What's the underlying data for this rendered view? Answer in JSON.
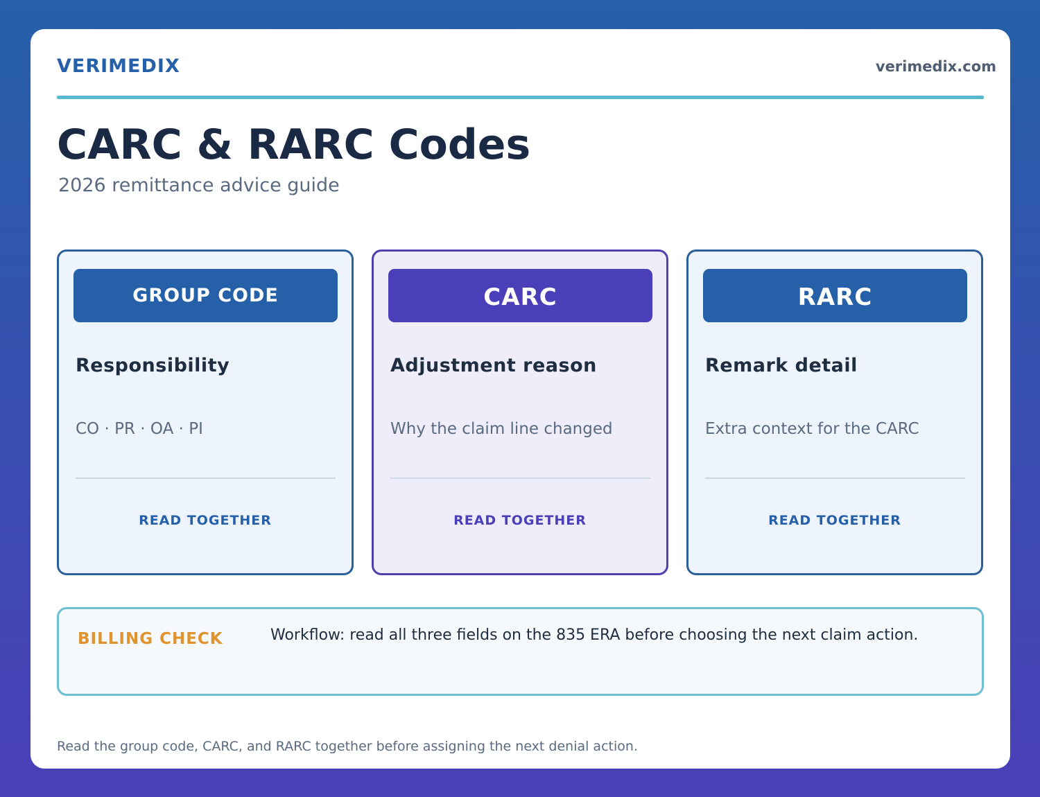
{
  "header": {
    "brand": "VERIMEDIX",
    "site": "verimedix.com"
  },
  "title": "CARC & RARC Codes",
  "subtitle": "2026 remittance advice guide",
  "panels": [
    {
      "head": "GROUP CODE",
      "title": "Responsibility",
      "description": "CO · PR · OA · PI",
      "footer": "READ TOGETHER",
      "accent": "#2560a8"
    },
    {
      "head": "CARC",
      "title": "Adjustment reason",
      "description": "Why the claim line changed",
      "footer": "READ TOGETHER",
      "accent": "#4a3fb8"
    },
    {
      "head": "RARC",
      "title": "Remark detail",
      "description": "Extra context for the CARC",
      "footer": "READ TOGETHER",
      "accent": "#2560a8"
    }
  ],
  "billing_check": {
    "label": "BILLING CHECK",
    "message": "Workflow: read all three fields on the 835 ERA before choosing the next claim action.",
    "accent": "#e0932e"
  },
  "footer": "Read the group code, CARC, and RARC together before assigning the next denial action."
}
